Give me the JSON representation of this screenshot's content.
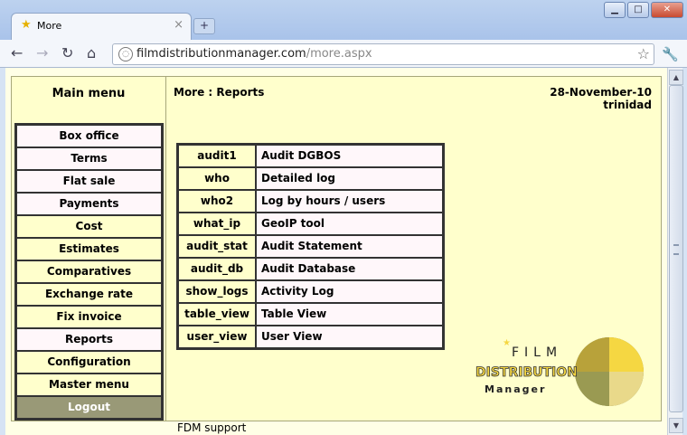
{
  "browser": {
    "tab_title": "More",
    "url_host": "filmdistributionmanager.com",
    "url_path": "/more.aspx"
  },
  "sidebar": {
    "title": "Main menu",
    "items": [
      {
        "label": "Box office",
        "style": "pink"
      },
      {
        "label": "Terms",
        "style": "pink"
      },
      {
        "label": "Flat sale",
        "style": "pink"
      },
      {
        "label": "Payments",
        "style": "pink"
      },
      {
        "label": "Cost",
        "style": "yellow"
      },
      {
        "label": "Estimates",
        "style": "yellow"
      },
      {
        "label": "Comparatives",
        "style": "yellow"
      },
      {
        "label": "Exchange rate",
        "style": "yellow"
      },
      {
        "label": "Fix invoice",
        "style": "yellow"
      },
      {
        "label": "Reports",
        "style": "pink"
      },
      {
        "label": "Configuration",
        "style": "yellow"
      },
      {
        "label": "Master menu",
        "style": "yellow"
      },
      {
        "label": "Logout",
        "style": "logout"
      }
    ]
  },
  "content": {
    "heading": "More : Reports",
    "date": "28-November-10",
    "user": "trinidad",
    "reports": [
      {
        "code": "audit1",
        "description": "Audit DGBOS"
      },
      {
        "code": "who",
        "description": "Detailed log"
      },
      {
        "code": "who2",
        "description": "Log by hours / users"
      },
      {
        "code": "what_ip",
        "description": "GeoIP tool"
      },
      {
        "code": "audit_stat",
        "description": "Audit Statement"
      },
      {
        "code": "audit_db",
        "description": "Audit Database"
      },
      {
        "code": "show_logs",
        "description": "Activity Log"
      },
      {
        "code": "table_view",
        "description": "Table View"
      },
      {
        "code": "user_view",
        "description": "User View"
      }
    ],
    "support_text": "FDM support"
  },
  "logo": {
    "line1": "FILM",
    "line2": "DISTRIBUTION",
    "line3": "Manager"
  },
  "colors": {
    "page_bg": "#ffffcc",
    "pink_cell": "#fff7fa",
    "logout_bg": "#999977",
    "logo_gold": "#f5d742",
    "logo_olive": "#7a7a3a"
  }
}
